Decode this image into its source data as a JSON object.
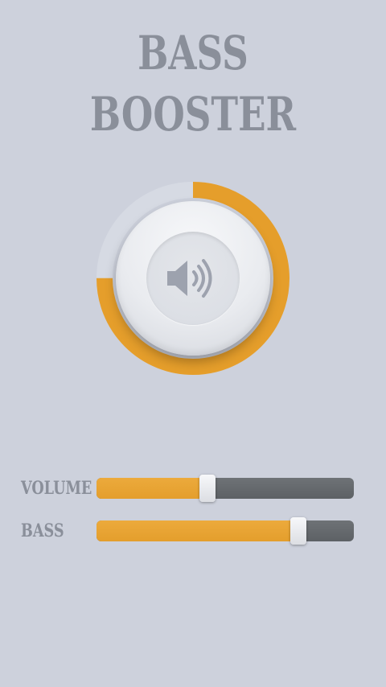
{
  "app": {
    "title": "BASS BOOSTER"
  },
  "knob": {
    "level": 0.75,
    "icon": "speaker-volume-icon"
  },
  "sliders": {
    "volume": {
      "label": "VOLUME",
      "value": 0.43
    },
    "bass": {
      "label": "BASS",
      "value": 0.785
    }
  },
  "colors": {
    "background": "#cdd1dc",
    "accent": "#e59e2b",
    "track": "#62666a",
    "text": "#8a8f9a",
    "ring_empty": "#d6dae3"
  }
}
